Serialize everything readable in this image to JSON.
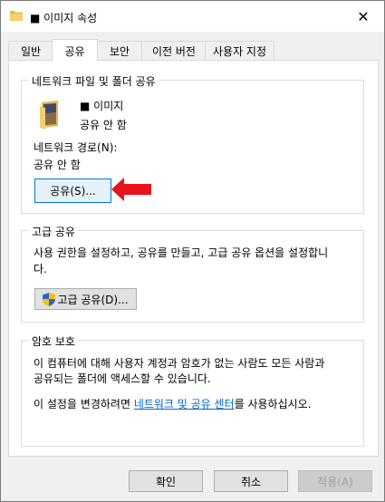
{
  "window": {
    "title": "■ 이미지 속성",
    "close_glyph": "✕"
  },
  "tabs": [
    {
      "label": "일반"
    },
    {
      "label": "공유"
    },
    {
      "label": "보안"
    },
    {
      "label": "이전 버전"
    },
    {
      "label": "사용자 지정"
    }
  ],
  "network_share": {
    "group_title": "네트워크 파일 및 폴더 공유",
    "folder_name": "■ 이미지",
    "folder_status": "공유 안 함",
    "path_label": "네트워크 경로(N):",
    "path_value": "공유 안 함",
    "share_button": "공유(S)..."
  },
  "advanced_share": {
    "group_title": "고급 공유",
    "description_line1": "사용 권한을 설정하고, 공유를 만들고, 고급 공유 옵션을 설정합니",
    "description_line2": "다.",
    "button": "고급 공유(D)..."
  },
  "password_protection": {
    "group_title": "암호 보호",
    "description_line1": "이 컴퓨터에 대해 사용자 계정과 암호가 없는 사람도 모든 사람과",
    "description_line2": "공유되는 폴더에 액세스할 수 있습니다.",
    "change_prefix": "이 설정을 변경하려면 ",
    "change_link": "네트워크 및 공유 센터",
    "change_suffix": "를 사용하십시오."
  },
  "footer": {
    "ok": "확인",
    "cancel": "취소",
    "apply": "적용(A)"
  },
  "colors": {
    "accent": "#0078d7",
    "arrow": "#e8141b",
    "link": "#0066cc"
  }
}
